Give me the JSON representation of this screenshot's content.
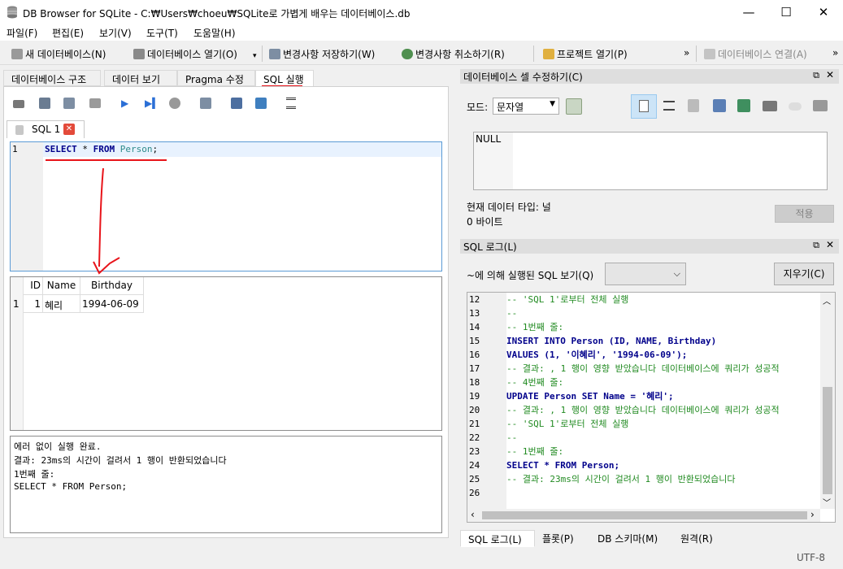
{
  "window": {
    "title": "DB Browser for SQLite - C:₩Users₩choeu₩SQLite로 가볍게 배우는 데이터베이스.db",
    "min": "—",
    "max": "☐",
    "close": "✕"
  },
  "menu": [
    "파일(F)",
    "편집(E)",
    "보기(V)",
    "도구(T)",
    "도움말(H)"
  ],
  "toolbar": {
    "new_db": "새 데이터베이스(N)",
    "open_db": "데이터베이스 열기(O)",
    "write": "변경사항 저장하기(W)",
    "revert": "변경사항 취소하기(R)",
    "open_project": "프로젝트 열기(P)",
    "attach": "데이터베이스 연결(A)",
    "more": "»"
  },
  "tabs": [
    "데이터베이스 구조",
    "데이터 보기",
    "Pragma 수정",
    "SQL 실행"
  ],
  "sql_tab": {
    "label": "SQL 1",
    "line": "1",
    "kw_select": "SELECT",
    "star": " * ",
    "kw_from": "FROM",
    "table": "Person",
    "semi": ";"
  },
  "results": {
    "columns": [
      "ID",
      "Name",
      "Birthday"
    ],
    "rows": [
      {
        "rownum": "1",
        "id": "1",
        "name": "혜리",
        "birthday": "1994-06-09"
      }
    ]
  },
  "message": [
    "에러 없이 실행 완료.",
    "결과: 23ms의 시간이 걸려서 1 행이 반환되었습니다",
    "1번째 줄:",
    "SELECT * FROM Person;"
  ],
  "edit_cell": {
    "title": "데이터베이스 셀 수정하기(C)",
    "mode_label": "모드:",
    "mode_value": "문자열",
    "value": "NULL",
    "type_text": "현재 데이터 타입: 널",
    "size_text": "0 바이트",
    "apply": "적용"
  },
  "sql_log": {
    "title": "SQL 로그(L)",
    "filter_label": "~에 의해 실행된 SQL 보기(Q)",
    "clear": "지우기(C)",
    "lines": [
      {
        "n": "12",
        "t": "-- 'SQL 1'로부터 전체 실행",
        "c": "cmt"
      },
      {
        "n": "13",
        "t": "--",
        "c": "cmt"
      },
      {
        "n": "14",
        "t": "-- 1번째 줄:",
        "c": "cmt"
      },
      {
        "n": "15",
        "t": "INSERT INTO Person (ID, NAME, Birthday)",
        "c": "code"
      },
      {
        "n": "16",
        "t": "VALUES (1, '이혜리', '1994-06-09');",
        "c": "code"
      },
      {
        "n": "17",
        "t": "-- 결과: , 1 행이 영향 받았습니다 데이터베이스에 쿼리가 성공적",
        "c": "cmt"
      },
      {
        "n": "18",
        "t": "-- 4번째 줄:",
        "c": "cmt"
      },
      {
        "n": "19",
        "t": "UPDATE Person SET Name = '혜리';",
        "c": "code"
      },
      {
        "n": "20",
        "t": "-- 결과: , 1 행이 영향 받았습니다 데이터베이스에 쿼리가 성공적",
        "c": "cmt"
      },
      {
        "n": "21",
        "t": "-- 'SQL 1'로부터 전체 실행",
        "c": "cmt"
      },
      {
        "n": "22",
        "t": "--",
        "c": "cmt"
      },
      {
        "n": "23",
        "t": "-- 1번째 줄:",
        "c": "cmt"
      },
      {
        "n": "24",
        "t": "SELECT * FROM Person;",
        "c": "code"
      },
      {
        "n": "25",
        "t": "-- 결과: 23ms의 시간이 걸려서 1 행이 반환되었습니다",
        "c": "cmt"
      },
      {
        "n": "26",
        "t": "",
        "c": "code"
      }
    ]
  },
  "bottom_tabs": [
    "SQL 로그(L)",
    "플롯(P)",
    "DB 스키마(M)",
    "원격(R)"
  ],
  "status": {
    "encoding": "UTF-8"
  },
  "colors": {
    "annotation": "#e8141a",
    "keyword": "#00008b",
    "table": "#2e8b8b",
    "string": "#b22222",
    "comment": "#228b22"
  }
}
